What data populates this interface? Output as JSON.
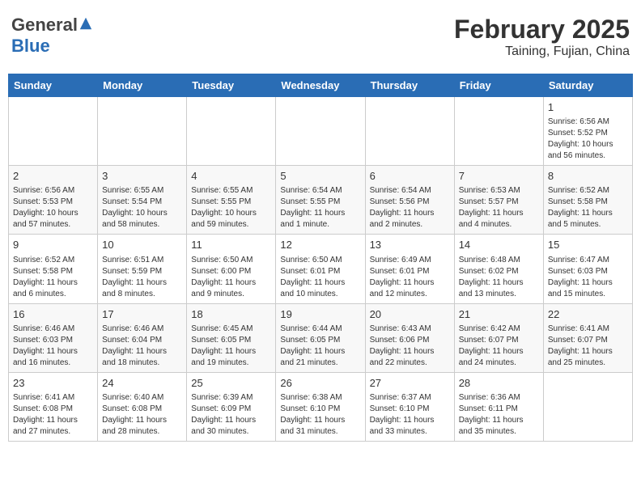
{
  "header": {
    "logo": {
      "text_general": "General",
      "text_blue": "Blue"
    },
    "month": "February 2025",
    "location": "Taining, Fujian, China"
  },
  "weekdays": [
    "Sunday",
    "Monday",
    "Tuesday",
    "Wednesday",
    "Thursday",
    "Friday",
    "Saturday"
  ],
  "weeks": [
    [
      {
        "day": "",
        "info": ""
      },
      {
        "day": "",
        "info": ""
      },
      {
        "day": "",
        "info": ""
      },
      {
        "day": "",
        "info": ""
      },
      {
        "day": "",
        "info": ""
      },
      {
        "day": "",
        "info": ""
      },
      {
        "day": "1",
        "info": "Sunrise: 6:56 AM\nSunset: 5:52 PM\nDaylight: 10 hours\nand 56 minutes."
      }
    ],
    [
      {
        "day": "2",
        "info": "Sunrise: 6:56 AM\nSunset: 5:53 PM\nDaylight: 10 hours\nand 57 minutes."
      },
      {
        "day": "3",
        "info": "Sunrise: 6:55 AM\nSunset: 5:54 PM\nDaylight: 10 hours\nand 58 minutes."
      },
      {
        "day": "4",
        "info": "Sunrise: 6:55 AM\nSunset: 5:55 PM\nDaylight: 10 hours\nand 59 minutes."
      },
      {
        "day": "5",
        "info": "Sunrise: 6:54 AM\nSunset: 5:55 PM\nDaylight: 11 hours\nand 1 minute."
      },
      {
        "day": "6",
        "info": "Sunrise: 6:54 AM\nSunset: 5:56 PM\nDaylight: 11 hours\nand 2 minutes."
      },
      {
        "day": "7",
        "info": "Sunrise: 6:53 AM\nSunset: 5:57 PM\nDaylight: 11 hours\nand 4 minutes."
      },
      {
        "day": "8",
        "info": "Sunrise: 6:52 AM\nSunset: 5:58 PM\nDaylight: 11 hours\nand 5 minutes."
      }
    ],
    [
      {
        "day": "9",
        "info": "Sunrise: 6:52 AM\nSunset: 5:58 PM\nDaylight: 11 hours\nand 6 minutes."
      },
      {
        "day": "10",
        "info": "Sunrise: 6:51 AM\nSunset: 5:59 PM\nDaylight: 11 hours\nand 8 minutes."
      },
      {
        "day": "11",
        "info": "Sunrise: 6:50 AM\nSunset: 6:00 PM\nDaylight: 11 hours\nand 9 minutes."
      },
      {
        "day": "12",
        "info": "Sunrise: 6:50 AM\nSunset: 6:01 PM\nDaylight: 11 hours\nand 10 minutes."
      },
      {
        "day": "13",
        "info": "Sunrise: 6:49 AM\nSunset: 6:01 PM\nDaylight: 11 hours\nand 12 minutes."
      },
      {
        "day": "14",
        "info": "Sunrise: 6:48 AM\nSunset: 6:02 PM\nDaylight: 11 hours\nand 13 minutes."
      },
      {
        "day": "15",
        "info": "Sunrise: 6:47 AM\nSunset: 6:03 PM\nDaylight: 11 hours\nand 15 minutes."
      }
    ],
    [
      {
        "day": "16",
        "info": "Sunrise: 6:46 AM\nSunset: 6:03 PM\nDaylight: 11 hours\nand 16 minutes."
      },
      {
        "day": "17",
        "info": "Sunrise: 6:46 AM\nSunset: 6:04 PM\nDaylight: 11 hours\nand 18 minutes."
      },
      {
        "day": "18",
        "info": "Sunrise: 6:45 AM\nSunset: 6:05 PM\nDaylight: 11 hours\nand 19 minutes."
      },
      {
        "day": "19",
        "info": "Sunrise: 6:44 AM\nSunset: 6:05 PM\nDaylight: 11 hours\nand 21 minutes."
      },
      {
        "day": "20",
        "info": "Sunrise: 6:43 AM\nSunset: 6:06 PM\nDaylight: 11 hours\nand 22 minutes."
      },
      {
        "day": "21",
        "info": "Sunrise: 6:42 AM\nSunset: 6:07 PM\nDaylight: 11 hours\nand 24 minutes."
      },
      {
        "day": "22",
        "info": "Sunrise: 6:41 AM\nSunset: 6:07 PM\nDaylight: 11 hours\nand 25 minutes."
      }
    ],
    [
      {
        "day": "23",
        "info": "Sunrise: 6:41 AM\nSunset: 6:08 PM\nDaylight: 11 hours\nand 27 minutes."
      },
      {
        "day": "24",
        "info": "Sunrise: 6:40 AM\nSunset: 6:08 PM\nDaylight: 11 hours\nand 28 minutes."
      },
      {
        "day": "25",
        "info": "Sunrise: 6:39 AM\nSunset: 6:09 PM\nDaylight: 11 hours\nand 30 minutes."
      },
      {
        "day": "26",
        "info": "Sunrise: 6:38 AM\nSunset: 6:10 PM\nDaylight: 11 hours\nand 31 minutes."
      },
      {
        "day": "27",
        "info": "Sunrise: 6:37 AM\nSunset: 6:10 PM\nDaylight: 11 hours\nand 33 minutes."
      },
      {
        "day": "28",
        "info": "Sunrise: 6:36 AM\nSunset: 6:11 PM\nDaylight: 11 hours\nand 35 minutes."
      },
      {
        "day": "",
        "info": ""
      }
    ]
  ]
}
